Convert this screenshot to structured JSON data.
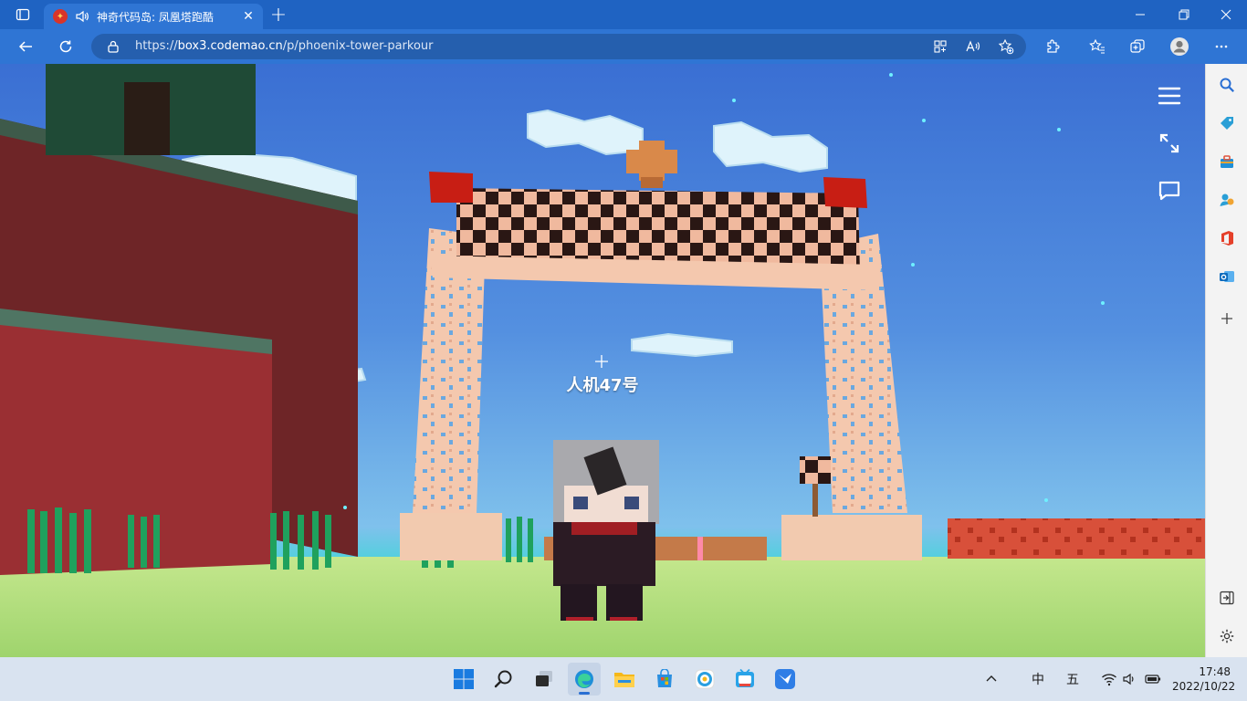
{
  "browser": {
    "tab_title": "神奇代码岛: 凤凰塔跑酷",
    "new_tab_label": "+",
    "url_scheme": "https://",
    "url_host": "box3.codemao.cn",
    "url_path": "/p/phoenix-tower-parkour"
  },
  "game": {
    "npc_name": "人机47号"
  },
  "taskbar": {
    "ime_lang": "中",
    "ime_mode": "五",
    "time": "17:48",
    "date": "2022/10/22"
  },
  "colors": {
    "tab_bar": "#1f63c2",
    "address_bar": "#2f75d4",
    "sky": "#5490e0",
    "taskbar": "#d9e3f0"
  }
}
